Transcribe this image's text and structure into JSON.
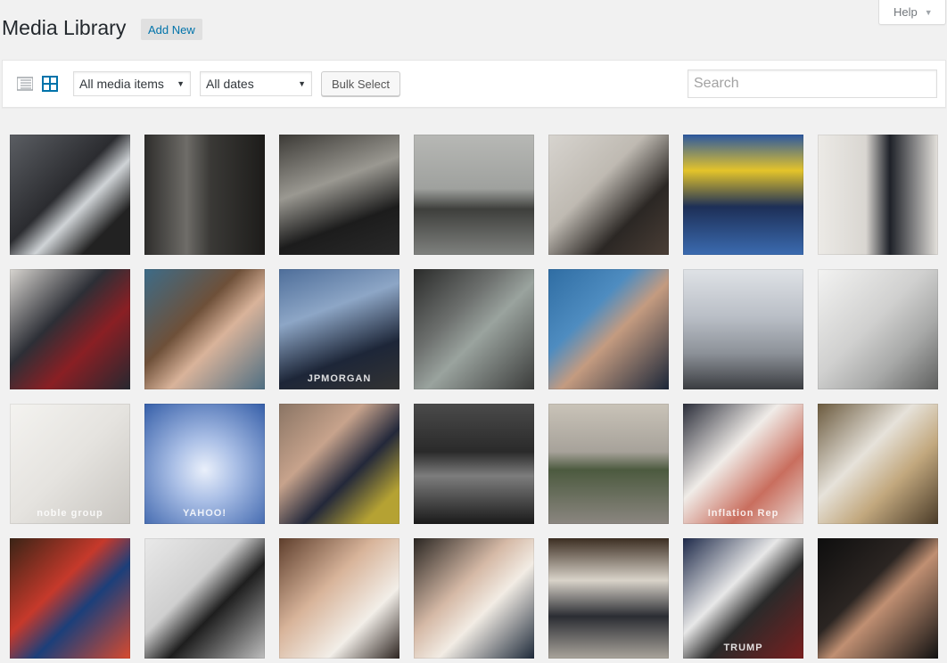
{
  "header": {
    "title": "Media Library",
    "add_new_label": "Add New",
    "help_label": "Help"
  },
  "toolbar": {
    "list_view_icon": "list-view-icon",
    "grid_view_icon": "grid-view-icon",
    "type_filter_value": "All media items",
    "date_filter_value": "All dates",
    "bulk_select_label": "Bulk Select",
    "search_placeholder": "Search"
  },
  "colors": {
    "accent": "#0073aa",
    "active_view": "#0073aa",
    "inactive_view": "#a0a5aa"
  },
  "media_items": [
    {
      "name": "man-holding-un-document",
      "bg": "linear-gradient(135deg,#5b5e63 0%,#2b2c30 45%,#cfd3d6 60%,#222 80%)",
      "caption": ""
    },
    {
      "name": "man-in-doorway",
      "bg": "linear-gradient(90deg,#2e2d2b 0%,#6e6c68 35%,#3a3936 55%,#1d1c1a 100%)",
      "caption": ""
    },
    {
      "name": "man-white-hair-suit",
      "bg": "linear-gradient(160deg,#3c3a36 0%,#9a9891 40%,#1c1c1c 70%,#2a2a2a 100%)",
      "caption": ""
    },
    {
      "name": "oil-platform-at-sea",
      "bg": "linear-gradient(180deg,#b7b8b5 0%,#9fa19e 45%,#3e3f3c 62%,#7f817e 100%)",
      "caption": ""
    },
    {
      "name": "speaker-at-microphone",
      "bg": "linear-gradient(135deg,#d7d4cf 0%,#bfbab2 40%,#2b2724 70%,#4a3e36 100%)",
      "caption": ""
    },
    {
      "name": "politician-with-crowd",
      "bg": "linear-gradient(180deg,#2b58a0 0%,#e4c42a 30%,#1d2f57 60%,#3b6bb0 100%)",
      "caption": ""
    },
    {
      "name": "man-with-red-folder",
      "bg": "linear-gradient(90deg,#eceae6 0%,#d9d6d1 40%,#1e2128 60%,#e5e2dd 100%)",
      "caption": ""
    },
    {
      "name": "man-in-suit-smiling",
      "bg": "linear-gradient(135deg,#d8d5d0 0%,#2d2f36 40%,#8a1f24 65%,#262830 100%)",
      "caption": ""
    },
    {
      "name": "woman-with-fringe",
      "bg": "linear-gradient(135deg,#3d6c88 0%,#6e5039 40%,#d9b39a 60%,#4e6e82 100%)",
      "caption": ""
    },
    {
      "name": "bank-skyscraper",
      "bg": "linear-gradient(160deg,#4e6e9a 0%,#8da6c6 35%,#1d2638 70%,#333 100%)",
      "caption": "JPMORGAN"
    },
    {
      "name": "lit-cube-sculpture",
      "bg": "linear-gradient(135deg,#2a2b2a 0%,#6c6f6d 35%,#9aa39e 55%,#3a3b3a 100%)",
      "caption": ""
    },
    {
      "name": "man-smiling-blue-background",
      "bg": "linear-gradient(135deg,#2f6da3 0%,#4e8cc0 35%,#c49b80 55%,#1b2638 100%)",
      "caption": ""
    },
    {
      "name": "apartment-block-queue",
      "bg": "linear-gradient(180deg,#dfe2e6 0%,#b9bec6 40%,#8c9198 70%,#3a3c40 100%)",
      "caption": ""
    },
    {
      "name": "white-car-badge",
      "bg": "linear-gradient(135deg,#f3f3f2 0%,#d0d0cf 45%,#a8a9a8 70%,#5e5f5e 100%)",
      "caption": ""
    },
    {
      "name": "noble-group-logo",
      "bg": "linear-gradient(135deg,#f4f3f0 0%,#e5e3df 50%,#c7c4bf 100%)",
      "caption": "noble group"
    },
    {
      "name": "yahoo-logo",
      "bg": "radial-gradient(circle at 50% 55%,#eaf0fb 0%,#aabfe6 35%,#355ea8 100%)",
      "caption": "YAHOO!"
    },
    {
      "name": "woman-with-glasses",
      "bg": "linear-gradient(135deg,#8a7464 0%,#c7a38c 35%,#23283a 60%,#b5a233 85%)",
      "caption": ""
    },
    {
      "name": "escalators-dark",
      "bg": "linear-gradient(180deg,#4a4a4a 0%,#2a2a2a 40%,#7d7d7d 60%,#1a1a1a 100%)",
      "caption": ""
    },
    {
      "name": "factory-reflection",
      "bg": "linear-gradient(180deg,#c9c3b8 0%,#a7a29a 40%,#4c5a3f 55%,#8b8680 100%)",
      "caption": ""
    },
    {
      "name": "man-inflation-report",
      "bg": "linear-gradient(135deg,#2b2e3a 0%,#f0ece8 40%,#c96e5e 70%,#e8d8d2 100%)",
      "caption": "Inflation Rep"
    },
    {
      "name": "man-in-headdress",
      "bg": "linear-gradient(135deg,#6b5a3e 0%,#e6e2da 40%,#c2a87e 65%,#4a3b28 100%)",
      "caption": ""
    },
    {
      "name": "chocolate-bars",
      "bg": "linear-gradient(135deg,#3a2416 0%,#c6392b 40%,#1c3f7a 60%,#d84a2e 100%)",
      "caption": ""
    },
    {
      "name": "fuel-nozzle-silhouette",
      "bg": "linear-gradient(135deg,#e9e9e9 0%,#cfcfcf 40%,#1e1e1e 60%,#bdbdbd 100%)",
      "caption": ""
    },
    {
      "name": "woman-waving",
      "bg": "linear-gradient(135deg,#5e3e2c 0%,#d8b49a 40%,#f2eee8 70%,#2d2420 100%)",
      "caption": ""
    },
    {
      "name": "senator-with-glasses",
      "bg": "linear-gradient(135deg,#2a2622 0%,#d5b9a6 40%,#f2ece4 60%,#1e2a3a 100%)",
      "caption": ""
    },
    {
      "name": "two-men-meeting",
      "bg": "linear-gradient(180deg,#3c2e22 0%,#d9d3c9 35%,#2b2d33 65%,#a9a49b 100%)",
      "caption": ""
    },
    {
      "name": "trump-signs-rally",
      "bg": "linear-gradient(135deg,#1e2a4a 0%,#e8e8e8 40%,#2a2a2a 60%,#7a1f1f 100%)",
      "caption": "TRUMP"
    },
    {
      "name": "man-in-dark-shadow",
      "bg": "linear-gradient(135deg,#0e0e0e 0%,#2b2522 40%,#c08f72 55%,#111 100%)",
      "caption": ""
    }
  ]
}
